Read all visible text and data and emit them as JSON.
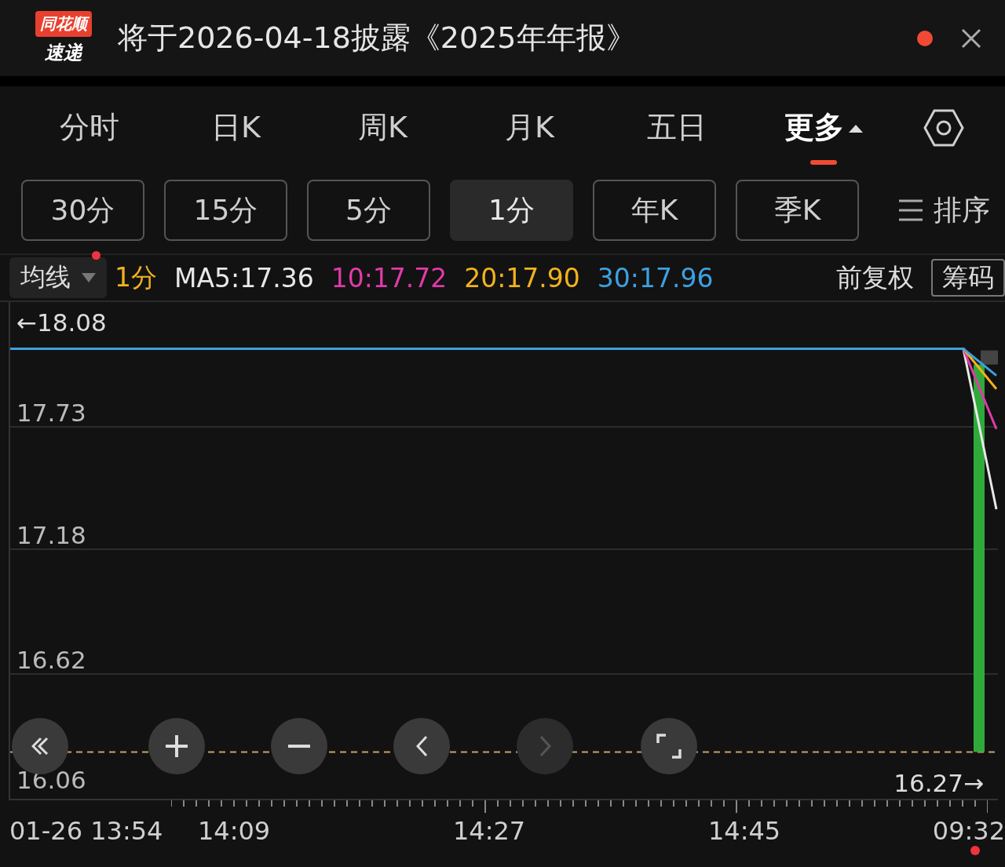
{
  "header": {
    "logo_top": "同花顺",
    "logo_bottom": "速递",
    "title": "将于2026-04-18披露《2025年年报》",
    "unread": true
  },
  "period_tabs": [
    {
      "label": "分时",
      "selected": false,
      "kind": "tab"
    },
    {
      "label": "日K",
      "selected": false,
      "kind": "tab"
    },
    {
      "label": "周K",
      "selected": false,
      "kind": "tab"
    },
    {
      "label": "月K",
      "selected": false,
      "kind": "tab"
    },
    {
      "label": "五日",
      "selected": false,
      "kind": "tab"
    },
    {
      "label": "更多",
      "selected": true,
      "kind": "menu"
    }
  ],
  "interval_chips": [
    {
      "label": "30分",
      "selected": false
    },
    {
      "label": "15分",
      "selected": false
    },
    {
      "label": "5分",
      "selected": false
    },
    {
      "label": "1分",
      "selected": true
    },
    {
      "label": "年K",
      "selected": false
    },
    {
      "label": "季K",
      "selected": false
    }
  ],
  "sort_button": {
    "label": "排序"
  },
  "indicator_bar": {
    "selector": "均线",
    "has_notice": true,
    "period": "1分",
    "ma": [
      {
        "label": "MA5:17.36",
        "color": "#e8e8e8"
      },
      {
        "label": "10:17.72",
        "color": "#e03aa8"
      },
      {
        "label": "20:17.90",
        "color": "#f2b21c"
      },
      {
        "label": "30:17.96",
        "color": "#3ea0e0"
      }
    ],
    "adjust": "前复权",
    "chips_button": "筹码"
  },
  "chart": {
    "max_label": "←18.08",
    "last_price_label": "16.27→",
    "y_labels": [
      "17.73",
      "17.18",
      "16.62",
      "16.06"
    ],
    "x_labels": [
      "01-26 13:54",
      "14:09",
      "14:27",
      "14:45",
      "09:32"
    ]
  },
  "chart_controls": [
    {
      "kind": "rewind",
      "disabled": false
    },
    {
      "kind": "zoom_in",
      "disabled": false
    },
    {
      "kind": "zoom_out",
      "disabled": false
    },
    {
      "kind": "prev",
      "disabled": false
    },
    {
      "kind": "next",
      "disabled": true
    },
    {
      "kind": "fullscreen",
      "disabled": false
    }
  ]
}
